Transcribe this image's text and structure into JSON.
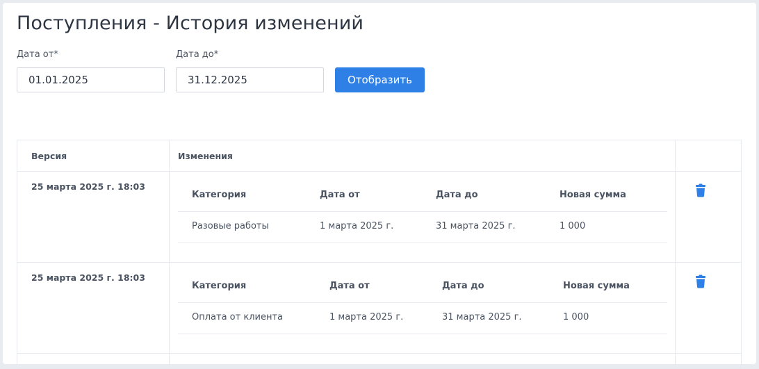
{
  "page_title": "Поступления - История изменений",
  "filters": {
    "date_from_label": "Дата от*",
    "date_from_value": "01.01.2025",
    "date_to_label": "Дата до*",
    "date_to_value": "31.12.2025",
    "show_button": "Отобразить"
  },
  "table": {
    "headers": {
      "version": "Версия",
      "changes": "Изменения"
    },
    "inner_headers": [
      "Категория",
      "Дата от",
      "Дата до",
      "Новая сумма"
    ],
    "rows": [
      {
        "version": "25 марта 2025 г. 18:03",
        "category": "Разовые работы",
        "date_from": "1 марта 2025 г.",
        "date_to": "31 марта 2025 г.",
        "amount": "1 000"
      },
      {
        "version": "25 марта 2025 г. 18:03",
        "category": "Оплата от клиента",
        "date_from": "1 марта 2025 г.",
        "date_to": "31 марта 2025 г.",
        "amount": "1 000"
      }
    ]
  },
  "icons": {
    "delete": "trash-icon"
  },
  "colors": {
    "accent": "#2f80e6",
    "border": "#e6e9ed",
    "text": "#4a5361"
  }
}
